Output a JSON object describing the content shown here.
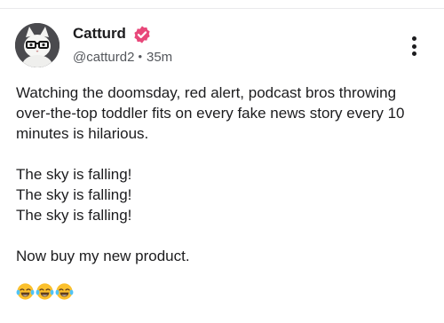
{
  "post": {
    "author_name": "Catturd",
    "handle": "@catturd2",
    "separator": "•",
    "time_ago": "35m",
    "paragraphs": [
      "Watching the doomsday, red alert, podcast bros throwing over-the-top toddler fits on every fake news story every 10 minutes is hilarious.",
      "The sky is falling!\nThe sky is falling!\nThe sky is falling!",
      "Now buy my new product."
    ],
    "emojis": [
      "😂",
      "😂",
      "😂"
    ],
    "icons": {
      "verified": "verified-badge-icon",
      "more": "more-options-icon",
      "emoji": "tears-of-joy-emoji"
    }
  },
  "colors": {
    "verified_badge": "#e8487a",
    "secondary_text": "#54575c",
    "primary_text": "#1c1c1e"
  }
}
